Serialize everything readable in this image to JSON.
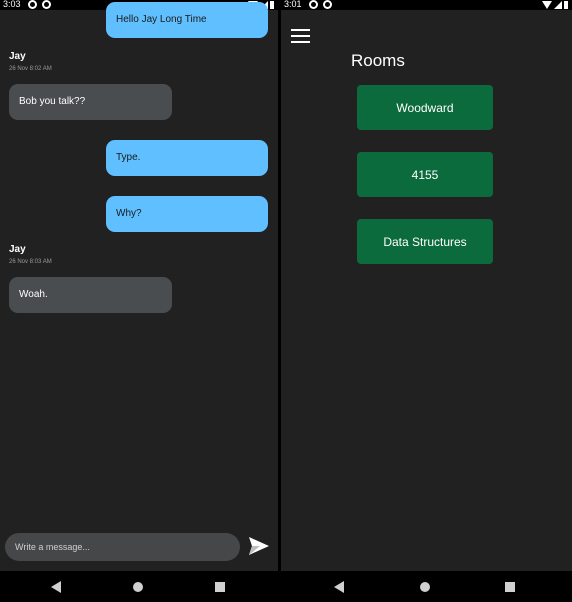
{
  "left_phone": {
    "status": {
      "time": "3:03"
    },
    "messages": [
      {
        "type": "outgoing",
        "text": "Hello Jay Long Time"
      },
      {
        "type": "incoming",
        "sender": "Jay",
        "timestamp": "26 Nov 8:02 AM",
        "text": "Bob you talk??"
      },
      {
        "type": "outgoing",
        "text": "Type."
      },
      {
        "type": "outgoing",
        "text": "Why?"
      },
      {
        "type": "incoming",
        "sender": "Jay",
        "timestamp": "26 Nov 8:03 AM",
        "text": "Woah."
      }
    ],
    "composer": {
      "placeholder": "Write a message...",
      "value": ""
    },
    "send_icon": "send-icon"
  },
  "right_phone": {
    "status": {
      "time": "3:01"
    },
    "menu_icon": "hamburger-menu-icon",
    "title": "Rooms",
    "rooms": [
      {
        "label": "Woodward"
      },
      {
        "label": "4155"
      },
      {
        "label": "Data Structures"
      }
    ]
  },
  "colors": {
    "background": "#212121",
    "outgoing_bubble": "#60c0ff",
    "incoming_bubble": "#4a4d4f",
    "room_button": "#0c6b3c"
  }
}
